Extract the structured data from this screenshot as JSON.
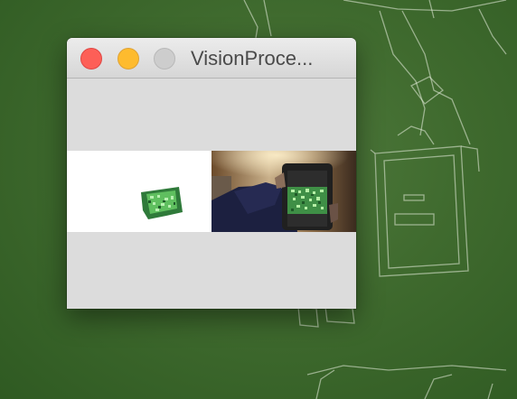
{
  "window": {
    "title": "VisionProce..."
  },
  "colors": {
    "desktop": "#3f6a2e",
    "window_bg": "#dcdcdc",
    "close": "#fd5f57",
    "minimize": "#febb2e",
    "zoom_disabled": "#cdcdcd",
    "detected_object": "#5fbf5f"
  },
  "icons": {
    "close": "close-button",
    "minimize": "minimize-button",
    "zoom": "zoom-button"
  }
}
